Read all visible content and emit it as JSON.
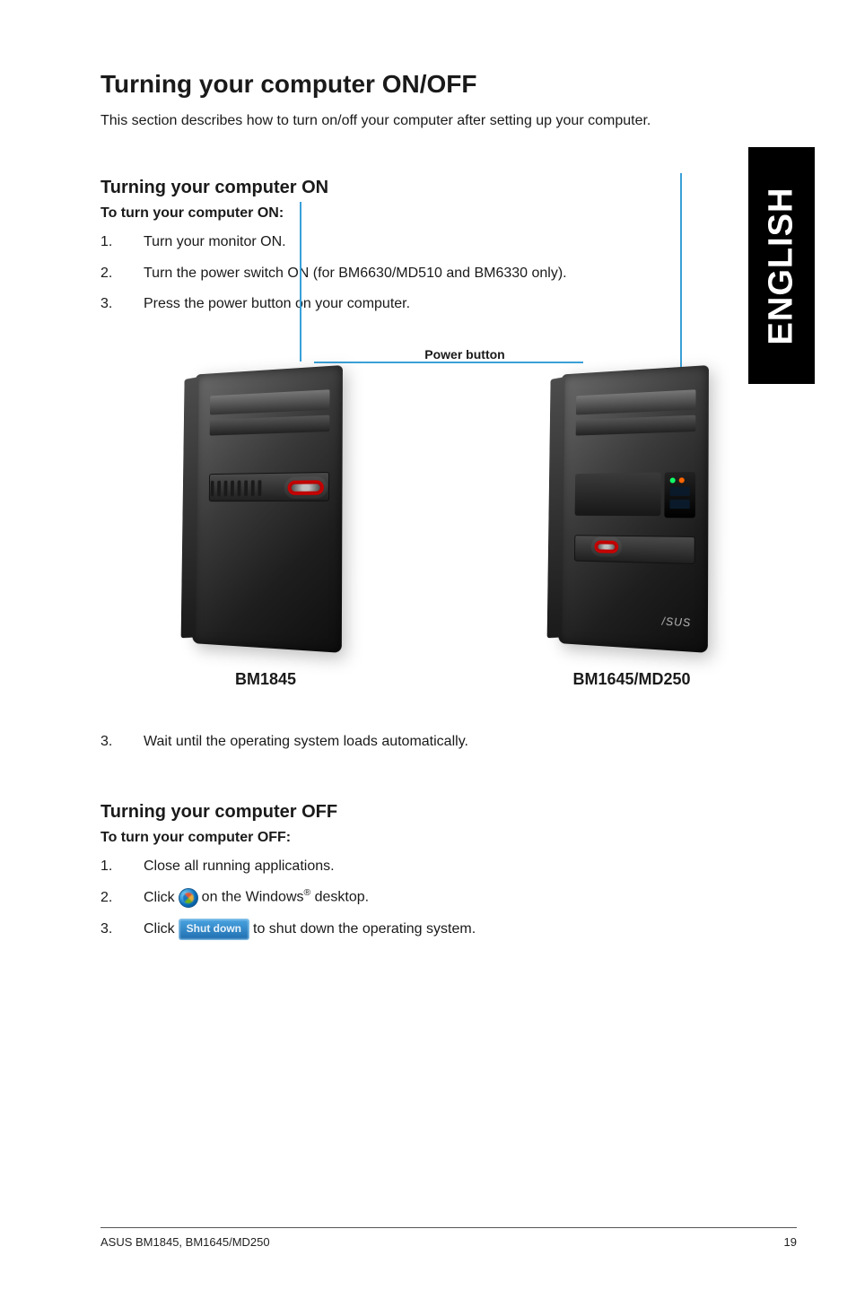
{
  "sideTab": "ENGLISH",
  "mainTitle": "Turning your computer ON/OFF",
  "intro": "This section describes how to turn on/off your computer after setting up your computer.",
  "on": {
    "heading": "Turning your computer ON",
    "lead": "To turn your computer ON:",
    "steps": [
      {
        "num": "1.",
        "text": "Turn your monitor ON."
      },
      {
        "num": "2.",
        "text": "Turn the power switch ON (for BM6630/MD510 and BM6330 only)."
      },
      {
        "num": "3.",
        "text": "Press the power button on your computer."
      }
    ],
    "powerButtonLabel": "Power button",
    "model1": "BM1845",
    "model2": "BM1645/MD250",
    "waitStep": {
      "num": "3.",
      "text": "Wait until the operating system loads automatically."
    }
  },
  "off": {
    "heading": "Turning your computer OFF",
    "lead": "To turn your computer OFF:",
    "steps": {
      "s1": {
        "num": "1.",
        "text": "Close all running applications."
      },
      "s2": {
        "num": "2.",
        "pre": "Click",
        "post": "on the Windows",
        "post2": " desktop."
      },
      "s3": {
        "num": "3.",
        "pre": "Click",
        "btn": "Shut down",
        "post": "to shut down the operating system."
      }
    }
  },
  "footer": {
    "left": "ASUS BM1845, BM1645/MD250",
    "right": "19"
  }
}
